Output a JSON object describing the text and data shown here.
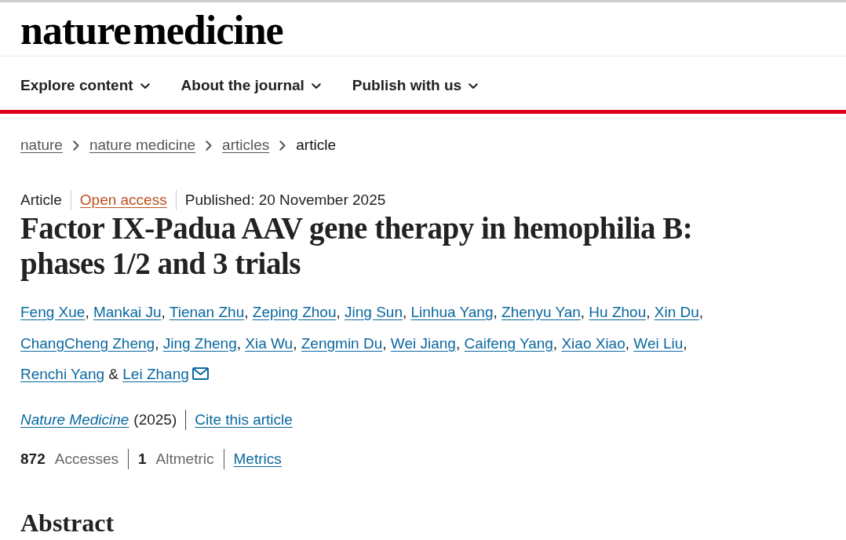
{
  "header": {
    "logo": "nature medicine",
    "nav": [
      {
        "label": "Explore content",
        "expanded": false
      },
      {
        "label": "About the journal",
        "expanded": false
      },
      {
        "label": "Publish with us",
        "expanded": false
      }
    ]
  },
  "breadcrumbs": [
    {
      "label": "nature",
      "kind": "link"
    },
    {
      "label": "nature medicine",
      "kind": "link"
    },
    {
      "label": "articles",
      "kind": "link"
    },
    {
      "label": "article",
      "kind": "current"
    }
  ],
  "article": {
    "type": "Article",
    "access": "Open access",
    "published": "Published: 20 November 2025",
    "title": "Factor IX-Padua AAV gene therapy in hemophilia B: phases 1/2 and 3 trials",
    "authors": [
      {
        "name": "Feng Xue",
        "corresponding": false,
        "after": ","
      },
      {
        "name": "Mankai Ju",
        "corresponding": false,
        "after": ","
      },
      {
        "name": "Tienan Zhu",
        "corresponding": false,
        "after": ","
      },
      {
        "name": "Zeping Zhou",
        "corresponding": false,
        "after": ","
      },
      {
        "name": "Jing Sun",
        "corresponding": false,
        "after": ","
      },
      {
        "name": "Linhua Yang",
        "corresponding": false,
        "after": ","
      },
      {
        "name": "Zhenyu Yan",
        "corresponding": false,
        "after": ","
      },
      {
        "name": "Hu Zhou",
        "corresponding": false,
        "after": ","
      },
      {
        "name": "Xin Du",
        "corresponding": false,
        "after": ","
      },
      {
        "name": "ChangCheng Zheng",
        "corresponding": false,
        "after": ","
      },
      {
        "name": "Jing Zheng",
        "corresponding": false,
        "after": ","
      },
      {
        "name": "Xia Wu",
        "corresponding": false,
        "after": ","
      },
      {
        "name": "Zengmin Du",
        "corresponding": false,
        "after": ","
      },
      {
        "name": "Wei Jiang",
        "corresponding": false,
        "after": ","
      },
      {
        "name": "Caifeng Yang",
        "corresponding": false,
        "after": ","
      },
      {
        "name": "Xiao Xiao",
        "corresponding": false,
        "after": ","
      },
      {
        "name": "Wei Liu",
        "corresponding": false,
        "after": ","
      },
      {
        "name": "Renchi Yang",
        "corresponding": false
      },
      {
        "name": "Lei Zhang",
        "corresponding": true
      }
    ],
    "conjunction": "&",
    "journal": "Nature Medicine",
    "year": "(2025)",
    "cite": "Cite this article",
    "metrics": [
      {
        "count": "872",
        "label": "Accesses"
      },
      {
        "count": "1",
        "label": "Altmetric"
      }
    ],
    "metrics_link": "Metrics",
    "section_heading": "Abstract"
  }
}
